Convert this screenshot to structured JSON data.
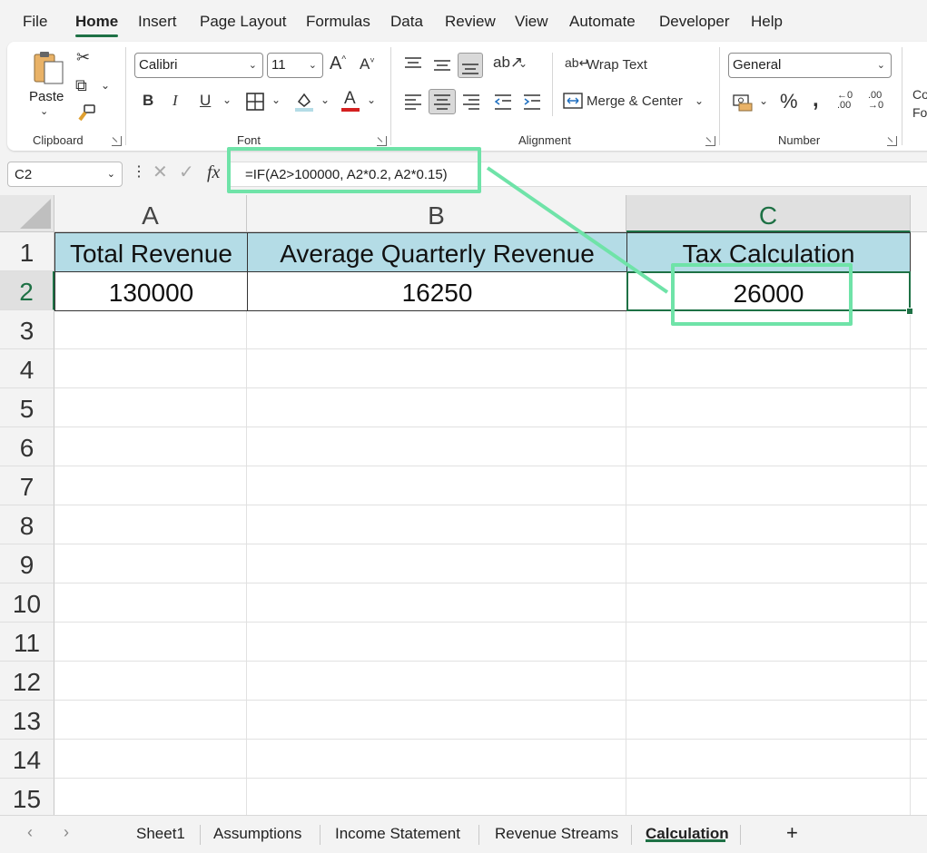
{
  "menu": {
    "items": [
      "File",
      "Home",
      "Insert",
      "Page Layout",
      "Formulas",
      "Data",
      "Review",
      "View",
      "Automate",
      "Developer",
      "Help"
    ],
    "active": "Home"
  },
  "ribbon": {
    "clipboard": {
      "paste_label": "Paste",
      "group_label": "Clipboard"
    },
    "font": {
      "font_name": "Calibri",
      "font_size": "11",
      "bold": "B",
      "italic": "I",
      "underline": "U",
      "font_color_glyph": "A",
      "group_label": "Font"
    },
    "alignment": {
      "wrap_text": "Wrap Text",
      "merge_center": "Merge & Center",
      "group_label": "Alignment"
    },
    "number": {
      "format": "General",
      "percent": "%",
      "comma": "9",
      "group_label": "Number"
    },
    "styles_partial": {
      "line1": "Co",
      "line2": "Fo"
    }
  },
  "formula_bar": {
    "name_box": "C2",
    "fx": "fx",
    "formula": "=IF(A2>100000, A2*0.2, A2*0.15)"
  },
  "sheet": {
    "columns": [
      "A",
      "B",
      "C"
    ],
    "rows": [
      "1",
      "2",
      "3",
      "4",
      "5",
      "6",
      "7",
      "8",
      "9",
      "10",
      "11",
      "12",
      "13",
      "14",
      "15"
    ],
    "headers": [
      "Total Revenue",
      "Average Quarterly Revenue",
      "Tax Calculation"
    ],
    "values": [
      "130000",
      "16250",
      "26000"
    ],
    "active_cell": "C2"
  },
  "tabs": {
    "items": [
      "Sheet1",
      "Assumptions",
      "Income Statement",
      "Revenue Streams",
      "Calculation"
    ],
    "active": "Calculation",
    "add": "+"
  },
  "colors": {
    "accent": "#1e7145",
    "header_fill": "#b4dce6",
    "highlight": "#6fe3a8"
  }
}
